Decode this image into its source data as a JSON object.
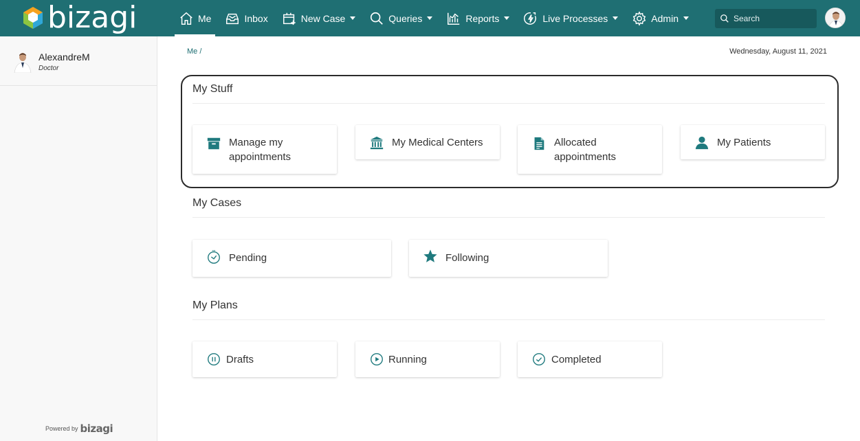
{
  "brand": {
    "name": "bizagi"
  },
  "nav": {
    "items": [
      {
        "label": "Me",
        "icon": "home-icon",
        "active": true
      },
      {
        "label": "Inbox",
        "icon": "inbox-icon"
      },
      {
        "label": "New Case",
        "icon": "new-case-icon",
        "dropdown": true
      },
      {
        "label": "Queries",
        "icon": "search-icon",
        "dropdown": true
      },
      {
        "label": "Reports",
        "icon": "chart-icon",
        "dropdown": true
      },
      {
        "label": "Live Processes",
        "icon": "lightning-icon",
        "dropdown": true
      },
      {
        "label": "Admin",
        "icon": "gear-icon",
        "dropdown": true
      }
    ],
    "search_placeholder": "Search"
  },
  "sidebar": {
    "user_name": "AlexandreM",
    "user_role": "Doctor",
    "powered_by": "Powered by",
    "powered_brand": "bizagi"
  },
  "main": {
    "breadcrumb": "Me /",
    "date": "Wednesday, August 11, 2021",
    "sections": {
      "my_stuff": {
        "title": "My Stuff",
        "cards": [
          {
            "label": "Manage my appointments",
            "line1": "Manage my",
            "line2": "appointments",
            "icon": "archive-box-icon"
          },
          {
            "label": "My Medical Centers",
            "icon": "institution-icon"
          },
          {
            "label": "Allocated appointments",
            "line1": "Allocated",
            "line2": "appointments",
            "icon": "document-icon"
          },
          {
            "label": "My Patients",
            "icon": "user-icon"
          }
        ]
      },
      "my_cases": {
        "title": "My Cases",
        "cards": [
          {
            "label": "Pending",
            "icon": "timer-icon"
          },
          {
            "label": "Following",
            "icon": "star-icon"
          }
        ]
      },
      "my_plans": {
        "title": "My Plans",
        "cards": [
          {
            "label": "Drafts",
            "icon": "pause-circle-icon"
          },
          {
            "label": "Running",
            "icon": "play-circle-icon"
          },
          {
            "label": "Completed",
            "icon": "check-circle-icon"
          }
        ]
      }
    }
  },
  "colors": {
    "brand_teal": "#1f6f73",
    "icon_teal": "#1f7a7e"
  }
}
